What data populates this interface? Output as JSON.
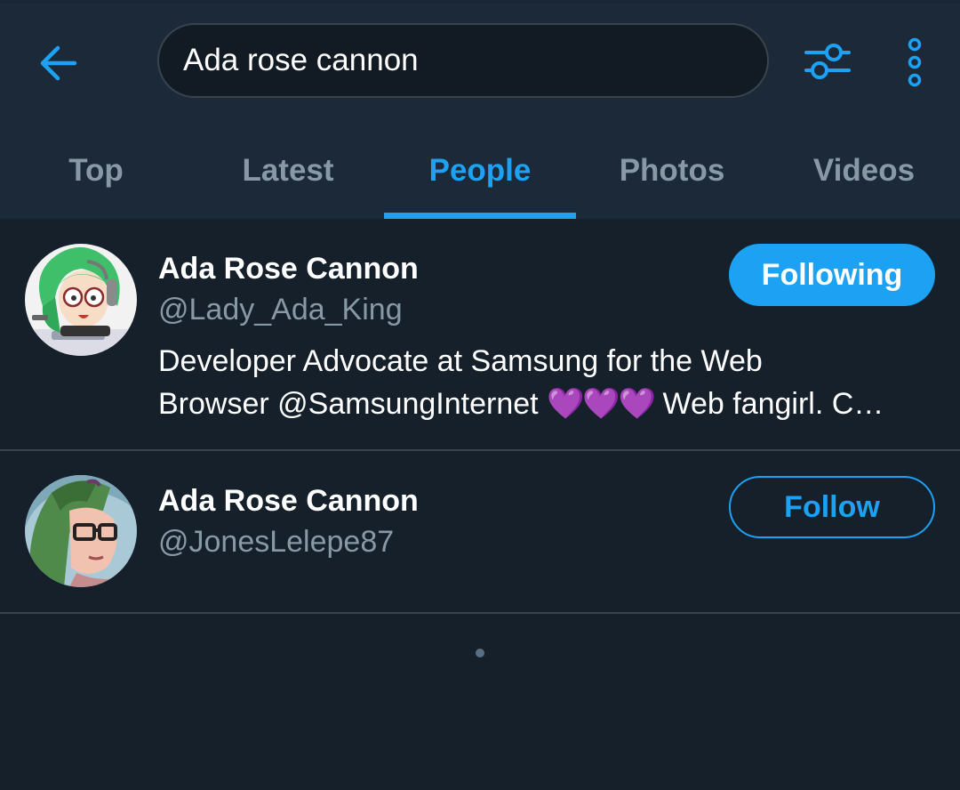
{
  "search": {
    "query": "Ada rose cannon"
  },
  "icons": {
    "back": "arrow-left-icon",
    "filter": "sliders-icon",
    "more": "vertical-dots-icon"
  },
  "tabs": [
    {
      "label": "Top",
      "active": false
    },
    {
      "label": "Latest",
      "active": false
    },
    {
      "label": "People",
      "active": true
    },
    {
      "label": "Photos",
      "active": false
    },
    {
      "label": "Videos",
      "active": false
    }
  ],
  "results": [
    {
      "name": "Ada Rose Cannon",
      "handle": "@Lady_Ada_King",
      "bio_line1": "Developer Advocate at Samsung for the Web",
      "bio_line2_start": "Browser @SamsungInternet ",
      "bio_hearts": "💜💜💜",
      "bio_line2_end": " Web fangirl. C…",
      "button": "Following"
    },
    {
      "name": "Ada Rose Cannon",
      "handle": "@JonesLelepe87",
      "button": "Follow"
    }
  ],
  "colors": {
    "accent": "#1da1f2",
    "background": "#15202b",
    "header": "#1c2938",
    "muted_text": "#8899a6",
    "divider": "#38444d"
  }
}
